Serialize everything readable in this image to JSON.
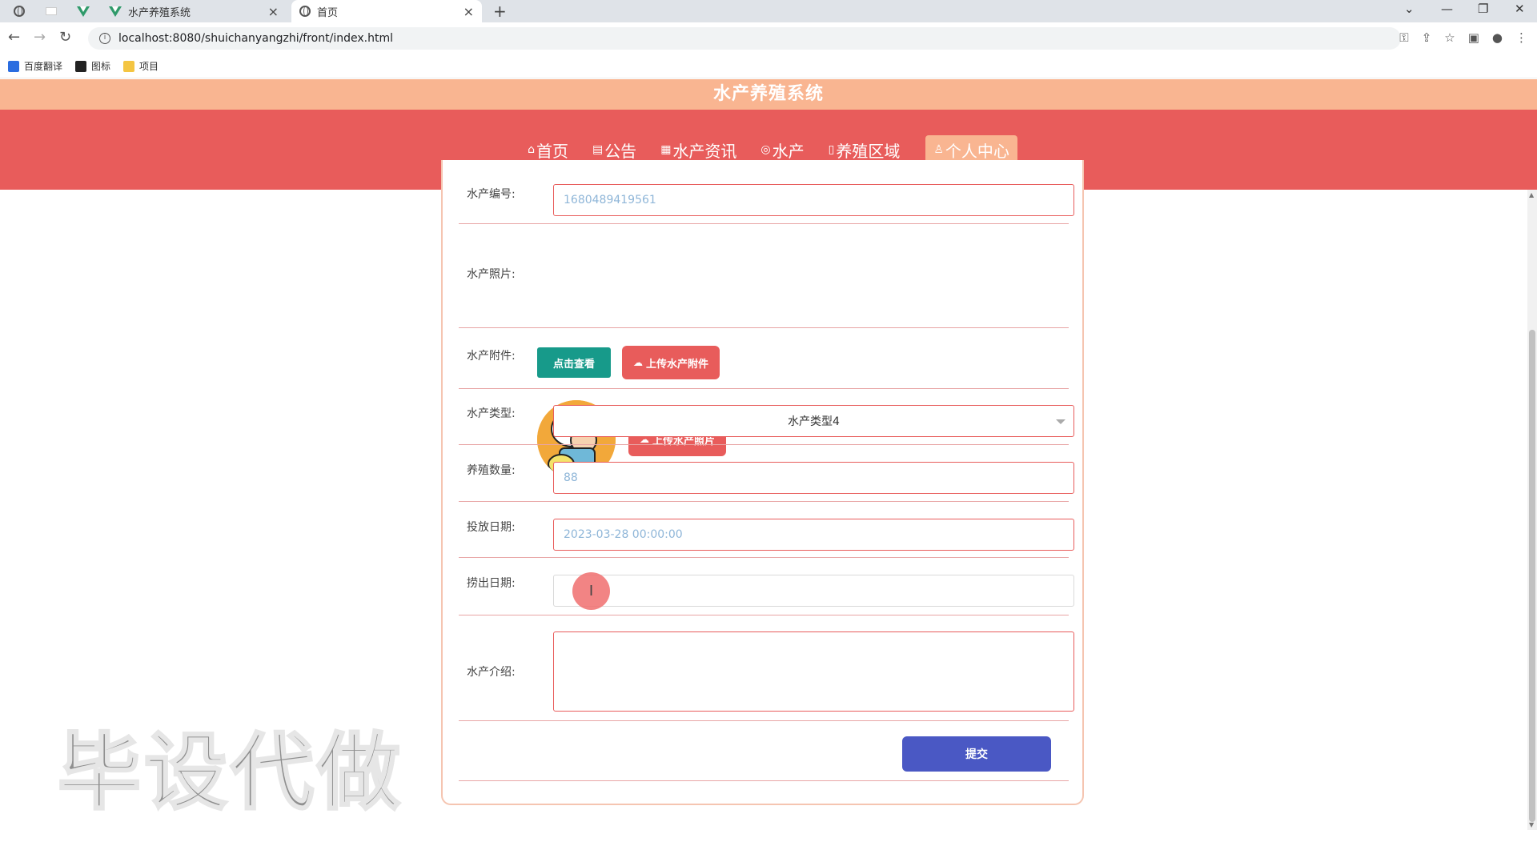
{
  "browser": {
    "tabs": [
      {
        "title": "水产养殖系统",
        "close": "×"
      },
      {
        "title": "首页",
        "close": "×"
      }
    ],
    "new_tab": "+",
    "url": "localhost:8080/shuichanyangzhi/front/index.html",
    "bookmarks": [
      "百度翻译",
      "图标",
      "项目"
    ],
    "window_controls": {
      "minimize": "—",
      "restore": "❐",
      "close": "✕",
      "dropdown": "⌄"
    }
  },
  "site": {
    "title": "水产养殖系统",
    "nav": [
      {
        "icon": "⌂",
        "label": "首页"
      },
      {
        "icon": "▤",
        "label": "公告"
      },
      {
        "icon": "▦",
        "label": "水产资讯"
      },
      {
        "icon": "◎",
        "label": "水产"
      },
      {
        "icon": "▯",
        "label": "养殖区域"
      },
      {
        "icon": "♙",
        "label": "个人中心"
      }
    ]
  },
  "form": {
    "fields": {
      "code": {
        "label": "水产编号:",
        "value": "1680489419561"
      },
      "photo": {
        "label": "水产照片:",
        "upload_button": "上传水产照片"
      },
      "attachment": {
        "label": "水产附件:",
        "view_button": "点击查看",
        "upload_button": "上传水产附件"
      },
      "type": {
        "label": "水产类型:",
        "value": "水产类型4"
      },
      "quantity": {
        "label": "养殖数量:",
        "value": "88"
      },
      "release_date": {
        "label": "投放日期:",
        "value": "2023-03-28 00:00:00"
      },
      "harvest_date": {
        "label": "捞出日期:",
        "value": ""
      },
      "intro": {
        "label": "水产介绍:",
        "value": ""
      }
    },
    "submit": "提交"
  },
  "watermark": "毕设代做",
  "colors": {
    "nav_red": "#e85c5b",
    "title_peach": "#f9b591",
    "teal": "#179a8a",
    "submit_blue": "#4a58c4"
  }
}
